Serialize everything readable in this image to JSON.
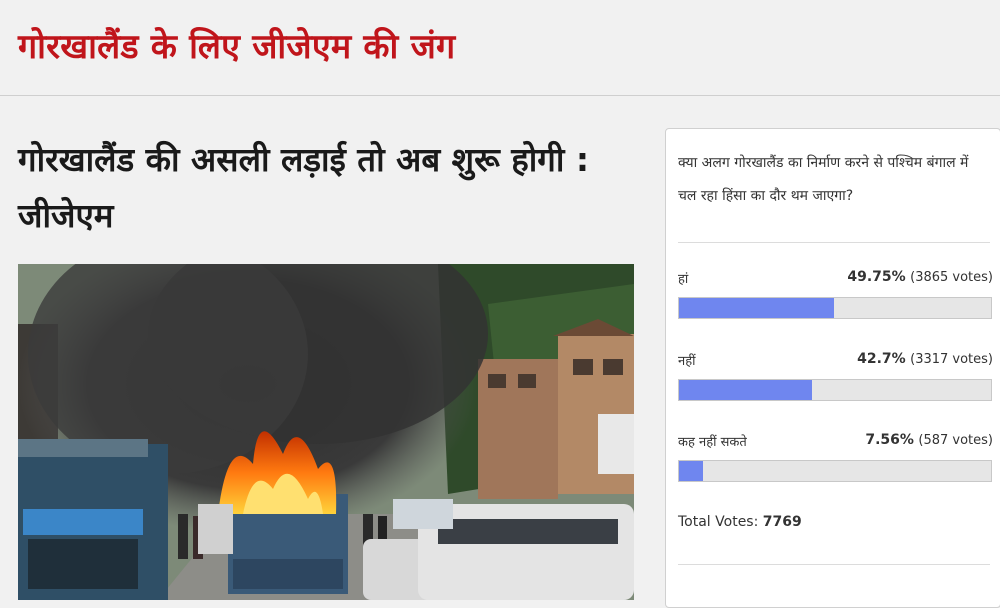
{
  "section": {
    "title": "गोरखालैंड के लिए जीजेएम की जंग"
  },
  "article": {
    "headline": "गोरखालैंड की असली लड़ाई तो अब शुरू होगी : जीजेएम",
    "image_alt": "burning vehicle on a street in the hills"
  },
  "poll": {
    "question": "क्या अलग गोरखालैंड का निर्माण करने से पश्चिम बंगाल में चल रहा हिंसा का दौर थम जाएगा?",
    "bar_color": "#6f86ef",
    "options": [
      {
        "label": "हां",
        "percent_text": "49.75%",
        "votes_text": "(3865 votes)",
        "percent": 49.75
      },
      {
        "label": "नहीं",
        "percent_text": "42.7%",
        "votes_text": "(3317 votes)",
        "percent": 42.7
      },
      {
        "label": "कह नहीं सकते",
        "percent_text": "7.56%",
        "votes_text": "(587 votes)",
        "percent": 7.56
      }
    ],
    "total_label": "Total Votes:",
    "total_value": "7769"
  },
  "colors": {
    "section_title": "#c0151b",
    "background": "#f1f1f1"
  }
}
